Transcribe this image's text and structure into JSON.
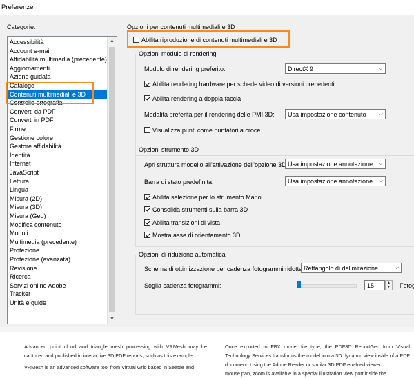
{
  "window": {
    "title": "Preferenze"
  },
  "categories": {
    "label": "Categorie:",
    "items": [
      "Accessibilità",
      "Account e-mail",
      "Affidabilità multimedia (precedente)",
      "Aggiornamenti",
      "Azione guidata",
      "Catalogo",
      "Contenuti multimediali e 3D",
      "Controllo ortografia",
      "Converti da PDF",
      "Converti in PDF",
      "Firme",
      "Gestione colore",
      "Gestore affidabilità",
      "Identità",
      "Internet",
      "JavaScript",
      "Lettura",
      "Lingua",
      "Misura (2D)",
      "Misura (3D)",
      "Misura (Geo)",
      "Modifica contenuto",
      "Moduli",
      "Multimedia (precedente)",
      "Protezione",
      "Protezione (avanzata)",
      "Revisione",
      "Ricerca",
      "Servizi online Adobe",
      "Tracker",
      "Unità e guide"
    ],
    "selected_index": 6
  },
  "media3d": {
    "title": "Opzioni per contenuti multimediali e 3D",
    "enable_playback": {
      "label": "Abilita riproduzione di contenuti multimediali e 3D",
      "checked": false
    }
  },
  "rendering": {
    "title": "Opzioni modulo di rendering",
    "preferred_label": "Modulo di rendering preferito:",
    "preferred_value": "DirectX 9",
    "hw_label": "Abilita rendering hardware per schede video di versioni precedenti",
    "doubleside_label": "Abilita rendering a doppia faccia",
    "pmi_label": "Modalità preferita per il rendering delle PMI 3D:",
    "pmi_value": "Usa impostazione contenuto",
    "pointers_label": "Visualizza punti come puntatori a croce"
  },
  "tool3d": {
    "title": "Opzioni strumento 3D",
    "tree_label": "Apri struttura modello all'attivazione dell'opzione 3D:",
    "tree_value": "Usa impostazione annotazione",
    "toolbar_label": "Barra di stato predefinita:",
    "toolbar_value": "Usa impostazione annotazione",
    "hand_label": "Abilita selezione per lo strumento Mano",
    "consolidate_label": "Consolida strumenti sulla barra 3D",
    "transitions_label": "Abilita transizioni di vista",
    "axes_label": "Mostra asse di orientamento 3D"
  },
  "reduction": {
    "title": "Opzioni di riduzione automatica",
    "scheme_label": "Schema di ottimizzazione per cadenza fotogrammi ridotta:",
    "scheme_value": "Rettangolo di delimitazione",
    "threshold_label": "Soglia cadenza fotogrammi:",
    "threshold_value": "15",
    "threshold_unit": "Fotog"
  },
  "highlight_color": "#f68b1f",
  "accent_color": "#0078d7",
  "document": {
    "col1_p1": "Advanced point cloud and triangle mesh processing with VRMesh may be captured and published in interactive 3D PDF reports, such as this example.",
    "col1_p2": "VRMesh is an advanced software tool from Virtual Grid based in Seattle and",
    "col2_p1": "Once exported to FBX model file type, the PDF3D ReportGen from Visual Technology Services transforms the model into a 3D dynamic view inside of a PDF document. Using the Adobe Reader or similar 3D PDF enabled viewer",
    "col2_p2": "mouse pan, zoom is available in a special illustration view port inside the"
  }
}
